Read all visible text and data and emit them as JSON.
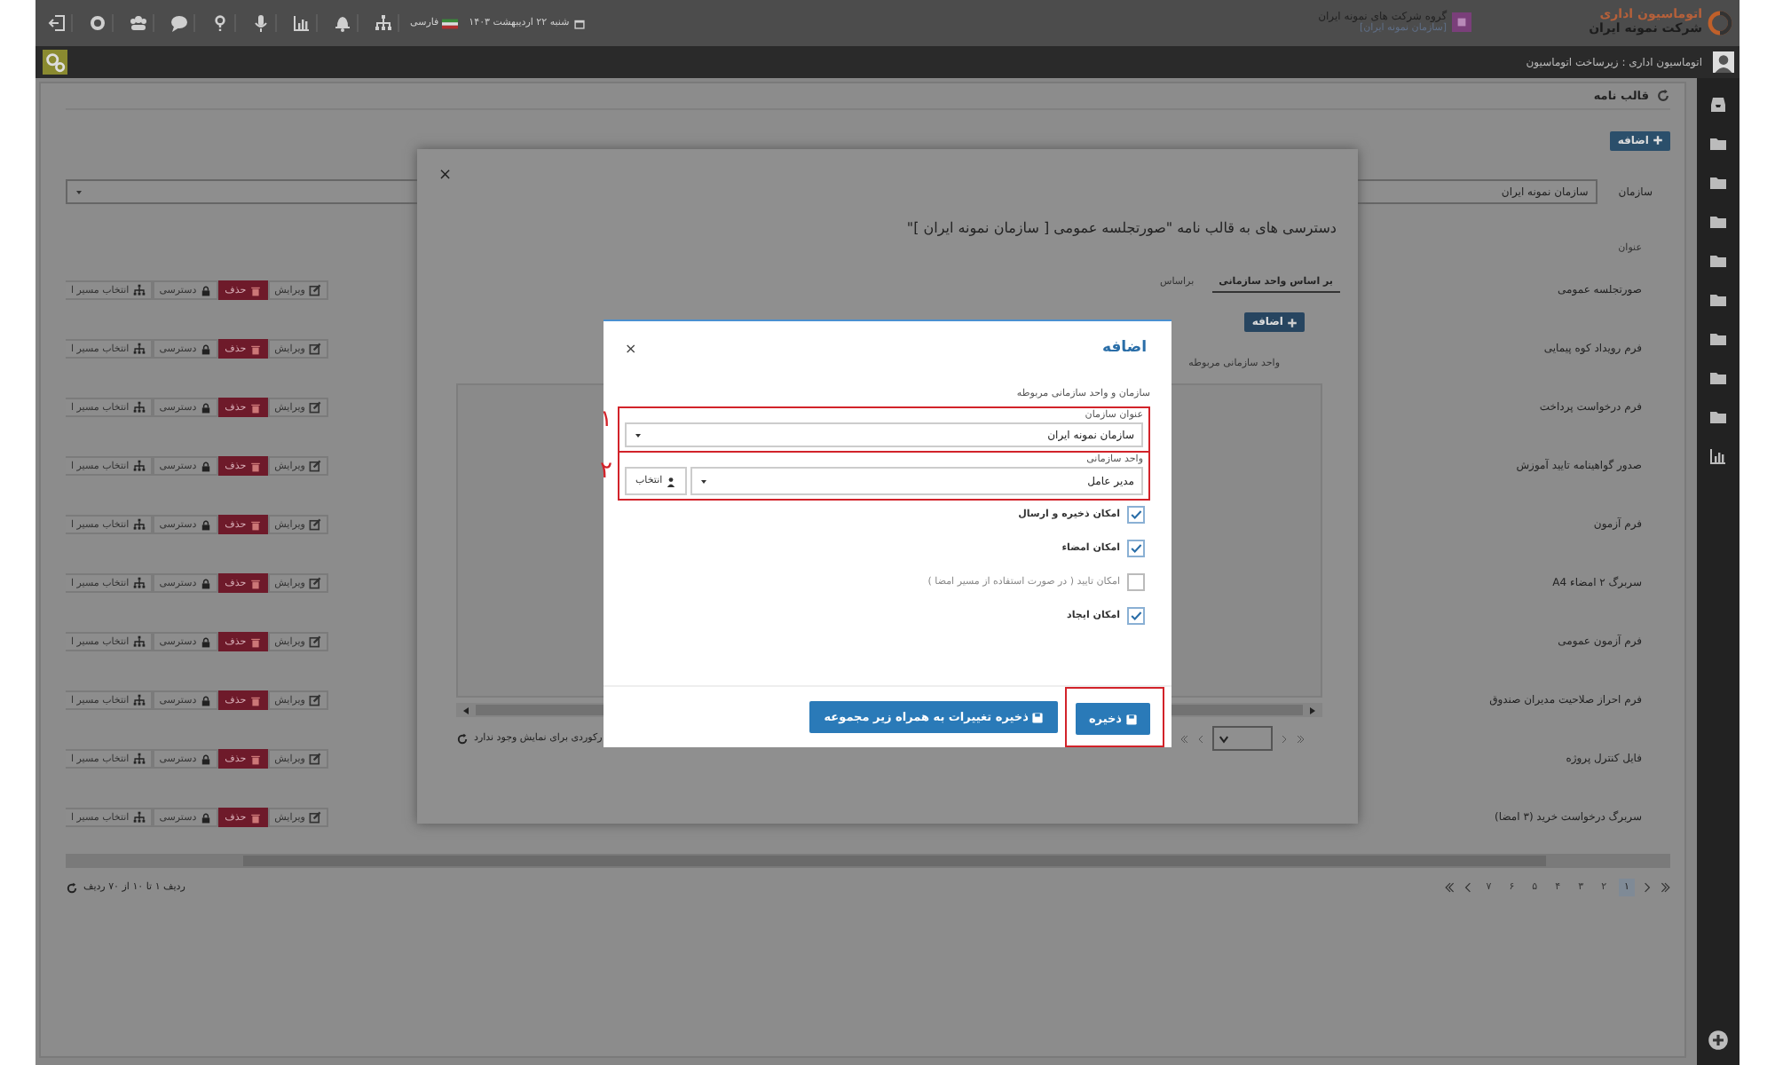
{
  "top_bar": {
    "logo_title": "اتوماسیون اداری",
    "logo_subtitle": "شرکت نمونه ایران",
    "group_name": "گروه شرکت های نمونه ایران",
    "org_name": "[سازمان نمونه ایران]",
    "date": "شنبه ۲۲ اردیبهشت ۱۴۰۳",
    "language": "فارسی"
  },
  "breadcrumb": "اتوماسیون اداری : زیرساخت اتوماسیون",
  "page": {
    "title": "قالب نامه",
    "add_button": "اضافه",
    "org_label": "سازمان",
    "org_value": "سازمان نمونه ایران",
    "column_title": "عنوان",
    "rows": [
      {
        "title": "صورتجلسه عمومی",
        "edit": "ویرایش",
        "delete": "حذف",
        "access": "دسترسی",
        "route": "انتخاب مسیر ا"
      },
      {
        "title": "فرم رویداد کوه پیمایی",
        "edit": "ویرایش",
        "delete": "حذف",
        "access": "دسترسی",
        "route": "انتخاب مسیر ا"
      },
      {
        "title": "فرم درخواست پرداخت",
        "edit": "ویرایش",
        "delete": "حذف",
        "access": "دسترسی",
        "route": "انتخاب مسیر ا"
      },
      {
        "title": "صدور گواهینامه تایید آموزش",
        "edit": "ویرایش",
        "delete": "حذف",
        "access": "دسترسی",
        "route": "انتخاب مسیر ا"
      },
      {
        "title": "فرم آزمون",
        "edit": "ویرایش",
        "delete": "حذف",
        "access": "دسترسی",
        "route": "انتخاب مسیر ا"
      },
      {
        "title": "سربرگ ۲ امضاء A4",
        "edit": "ویرایش",
        "delete": "حذف",
        "access": "دسترسی",
        "route": "انتخاب مسیر ا"
      },
      {
        "title": "فرم آزمون عمومی",
        "edit": "ویرایش",
        "delete": "حذف",
        "access": "دسترسی",
        "route": "انتخاب مسیر ا"
      },
      {
        "title": "فرم احراز صلاحیت مدیران صندوق",
        "edit": "ویرایش",
        "delete": "حذف",
        "access": "دسترسی",
        "route": "انتخاب مسیر ا"
      },
      {
        "title": "فایل کنترل پروژه",
        "edit": "ویرایش",
        "delete": "حذف",
        "access": "دسترسی",
        "route": "انتخاب مسیر ا"
      },
      {
        "title": "سربرگ درخواست خرید (۳ امضا)",
        "edit": "ویرایش",
        "delete": "حذف",
        "access": "دسترسی",
        "route": "انتخاب مسیر ا"
      }
    ],
    "pages": [
      {
        "label": "۱",
        "selected": true
      },
      {
        "label": "۲",
        "selected": false
      },
      {
        "label": "۳",
        "selected": false
      },
      {
        "label": "۴",
        "selected": false
      },
      {
        "label": "۵",
        "selected": false
      },
      {
        "label": "۶",
        "selected": false
      },
      {
        "label": "۷",
        "selected": false
      }
    ],
    "summary": "ردیف ۱ تا ۱۰ از ۷۰ ردیف"
  },
  "access_dialog": {
    "close": "×",
    "title": "دسترسی های به قالب نامه \"صورتجلسه عمومی [ سازمان نمونه ایران ]\"",
    "tabs": [
      {
        "label": "بر اساس واحد سازمانی",
        "selected": true
      },
      {
        "label": "براساس",
        "selected": false
      }
    ],
    "add_button": "اضافه",
    "column": "واحد سازمانی مربوطه",
    "empty_message": "رکوردی برای نمایش وجود ندارد"
  },
  "add_dialog": {
    "close": "×",
    "title": "اضافه",
    "section": "سازمان و واحد سازمانی مربوطه",
    "org_label": "عنوان سازمان",
    "org_value": "سازمان نمونه ایران",
    "unit_label": "واحد سازمانی",
    "unit_value": "مدیر عامل",
    "pick_button": "انتخاب",
    "options": [
      {
        "label": "امکان ذخیره و ارسال",
        "checked": true,
        "disabled": false
      },
      {
        "label": "امکان امضاء",
        "checked": true,
        "disabled": false
      },
      {
        "label": "امکان تایید ( در صورت استفاده از مسیر امضا )",
        "checked": false,
        "disabled": true
      },
      {
        "label": "امکان ایجاد",
        "checked": true,
        "disabled": false
      }
    ],
    "save_all_button": "ذخیره تغییرات به همراه زیر مجموعه",
    "save_button": "ذخیره"
  },
  "annotations": [
    "۱",
    "۲"
  ]
}
